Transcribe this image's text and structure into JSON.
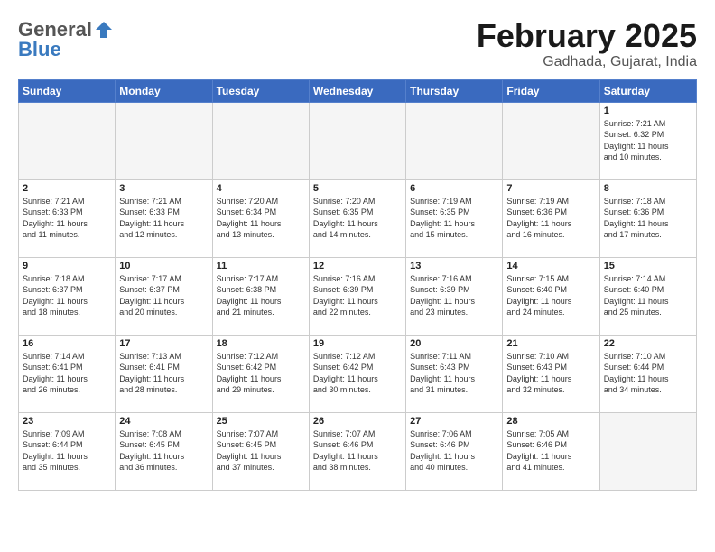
{
  "header": {
    "logo_general": "General",
    "logo_blue": "Blue",
    "title": "February 2025",
    "subtitle": "Gadhada, Gujarat, India"
  },
  "weekdays": [
    "Sunday",
    "Monday",
    "Tuesday",
    "Wednesday",
    "Thursday",
    "Friday",
    "Saturday"
  ],
  "weeks": [
    [
      {
        "day": "",
        "info": ""
      },
      {
        "day": "",
        "info": ""
      },
      {
        "day": "",
        "info": ""
      },
      {
        "day": "",
        "info": ""
      },
      {
        "day": "",
        "info": ""
      },
      {
        "day": "",
        "info": ""
      },
      {
        "day": "1",
        "info": "Sunrise: 7:21 AM\nSunset: 6:32 PM\nDaylight: 11 hours\nand 10 minutes."
      }
    ],
    [
      {
        "day": "2",
        "info": "Sunrise: 7:21 AM\nSunset: 6:33 PM\nDaylight: 11 hours\nand 11 minutes."
      },
      {
        "day": "3",
        "info": "Sunrise: 7:21 AM\nSunset: 6:33 PM\nDaylight: 11 hours\nand 12 minutes."
      },
      {
        "day": "4",
        "info": "Sunrise: 7:20 AM\nSunset: 6:34 PM\nDaylight: 11 hours\nand 13 minutes."
      },
      {
        "day": "5",
        "info": "Sunrise: 7:20 AM\nSunset: 6:35 PM\nDaylight: 11 hours\nand 14 minutes."
      },
      {
        "day": "6",
        "info": "Sunrise: 7:19 AM\nSunset: 6:35 PM\nDaylight: 11 hours\nand 15 minutes."
      },
      {
        "day": "7",
        "info": "Sunrise: 7:19 AM\nSunset: 6:36 PM\nDaylight: 11 hours\nand 16 minutes."
      },
      {
        "day": "8",
        "info": "Sunrise: 7:18 AM\nSunset: 6:36 PM\nDaylight: 11 hours\nand 17 minutes."
      }
    ],
    [
      {
        "day": "9",
        "info": "Sunrise: 7:18 AM\nSunset: 6:37 PM\nDaylight: 11 hours\nand 18 minutes."
      },
      {
        "day": "10",
        "info": "Sunrise: 7:17 AM\nSunset: 6:37 PM\nDaylight: 11 hours\nand 20 minutes."
      },
      {
        "day": "11",
        "info": "Sunrise: 7:17 AM\nSunset: 6:38 PM\nDaylight: 11 hours\nand 21 minutes."
      },
      {
        "day": "12",
        "info": "Sunrise: 7:16 AM\nSunset: 6:39 PM\nDaylight: 11 hours\nand 22 minutes."
      },
      {
        "day": "13",
        "info": "Sunrise: 7:16 AM\nSunset: 6:39 PM\nDaylight: 11 hours\nand 23 minutes."
      },
      {
        "day": "14",
        "info": "Sunrise: 7:15 AM\nSunset: 6:40 PM\nDaylight: 11 hours\nand 24 minutes."
      },
      {
        "day": "15",
        "info": "Sunrise: 7:14 AM\nSunset: 6:40 PM\nDaylight: 11 hours\nand 25 minutes."
      }
    ],
    [
      {
        "day": "16",
        "info": "Sunrise: 7:14 AM\nSunset: 6:41 PM\nDaylight: 11 hours\nand 26 minutes."
      },
      {
        "day": "17",
        "info": "Sunrise: 7:13 AM\nSunset: 6:41 PM\nDaylight: 11 hours\nand 28 minutes."
      },
      {
        "day": "18",
        "info": "Sunrise: 7:12 AM\nSunset: 6:42 PM\nDaylight: 11 hours\nand 29 minutes."
      },
      {
        "day": "19",
        "info": "Sunrise: 7:12 AM\nSunset: 6:42 PM\nDaylight: 11 hours\nand 30 minutes."
      },
      {
        "day": "20",
        "info": "Sunrise: 7:11 AM\nSunset: 6:43 PM\nDaylight: 11 hours\nand 31 minutes."
      },
      {
        "day": "21",
        "info": "Sunrise: 7:10 AM\nSunset: 6:43 PM\nDaylight: 11 hours\nand 32 minutes."
      },
      {
        "day": "22",
        "info": "Sunrise: 7:10 AM\nSunset: 6:44 PM\nDaylight: 11 hours\nand 34 minutes."
      }
    ],
    [
      {
        "day": "23",
        "info": "Sunrise: 7:09 AM\nSunset: 6:44 PM\nDaylight: 11 hours\nand 35 minutes."
      },
      {
        "day": "24",
        "info": "Sunrise: 7:08 AM\nSunset: 6:45 PM\nDaylight: 11 hours\nand 36 minutes."
      },
      {
        "day": "25",
        "info": "Sunrise: 7:07 AM\nSunset: 6:45 PM\nDaylight: 11 hours\nand 37 minutes."
      },
      {
        "day": "26",
        "info": "Sunrise: 7:07 AM\nSunset: 6:46 PM\nDaylight: 11 hours\nand 38 minutes."
      },
      {
        "day": "27",
        "info": "Sunrise: 7:06 AM\nSunset: 6:46 PM\nDaylight: 11 hours\nand 40 minutes."
      },
      {
        "day": "28",
        "info": "Sunrise: 7:05 AM\nSunset: 6:46 PM\nDaylight: 11 hours\nand 41 minutes."
      },
      {
        "day": "",
        "info": ""
      }
    ]
  ]
}
